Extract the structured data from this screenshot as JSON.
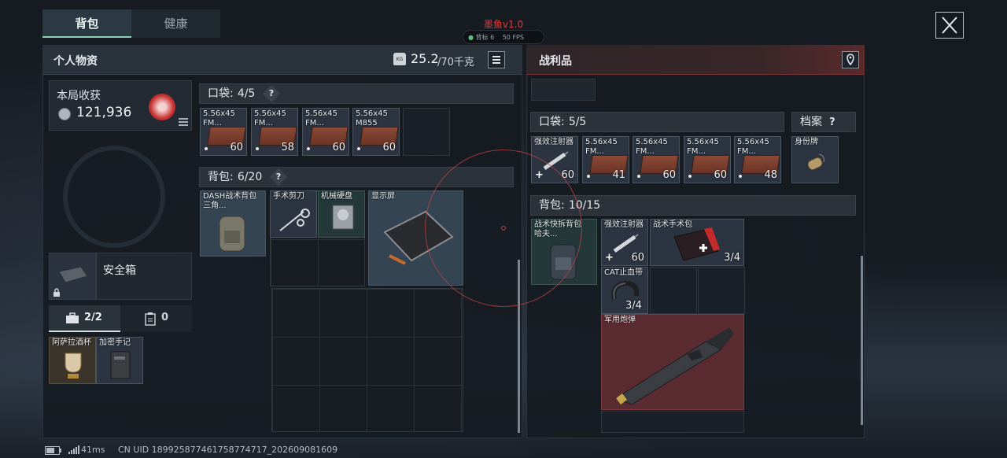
{
  "tabs": [
    {
      "label": "背包"
    },
    {
      "label": "健康"
    }
  ],
  "overlay": {
    "title": "墨鱼v1.0",
    "user": "背标 6",
    "fps": "50 FPS"
  },
  "left_panel": {
    "title": "个人物资",
    "weight_icon": "KG",
    "weight": "25.2",
    "weight_max": "/70千克",
    "harvest": {
      "label": "本局收获",
      "value": "121,936"
    },
    "pocket": {
      "label": "口袋:",
      "count": "4/5"
    },
    "pocket_items": [
      {
        "name": "5.56x45\nFM...",
        "count": "60"
      },
      {
        "name": "5.56x45\nFM...",
        "count": "58"
      },
      {
        "name": "5.56x45\nFM...",
        "count": "60"
      },
      {
        "name": "5.56x45\nM855",
        "count": "60"
      }
    ],
    "backpack": {
      "label": "背包:",
      "count": "6/20"
    },
    "backpack_items": [
      {
        "name": "DASH战术背包\n三角..."
      },
      {
        "name": "手术剪刀"
      },
      {
        "name": "机械硬盘"
      },
      {
        "name": "显示屏"
      }
    ],
    "safe_box": {
      "label": "安全箱"
    },
    "sub_tabs": [
      {
        "label": "2/2"
      },
      {
        "label": "0"
      }
    ],
    "safe_items": [
      {
        "name": "阿萨拉酒杯"
      },
      {
        "name": "加密手记"
      }
    ]
  },
  "right_panel": {
    "title": "战利品",
    "pocket": {
      "label": "口袋:",
      "count": "5/5"
    },
    "archive": {
      "label": "档案"
    },
    "pocket_items": [
      {
        "name": "强效注射器",
        "count": "60"
      },
      {
        "name": "5.56x45\nFM...",
        "count": "41"
      },
      {
        "name": "5.56x45\nFM...",
        "count": "60"
      },
      {
        "name": "5.56x45\nFM...",
        "count": "60"
      },
      {
        "name": "5.56x45\nFM...",
        "count": "48"
      }
    ],
    "archive_item": {
      "name": "身份牌"
    },
    "backpack": {
      "label": "背包:",
      "count": "10/15"
    },
    "backpack_items": [
      {
        "name": "战术快拆背包\n哈夫..."
      },
      {
        "name": "强效注射器",
        "count": "60"
      },
      {
        "name": "战术手术包",
        "count": "3/4"
      },
      {
        "name": "CAT止血带",
        "count": "3/4"
      },
      {
        "name": "军用炮弹"
      }
    ]
  },
  "status": {
    "ping": "41ms",
    "uid": "CN UID 189925877461758774717_202609081609"
  }
}
